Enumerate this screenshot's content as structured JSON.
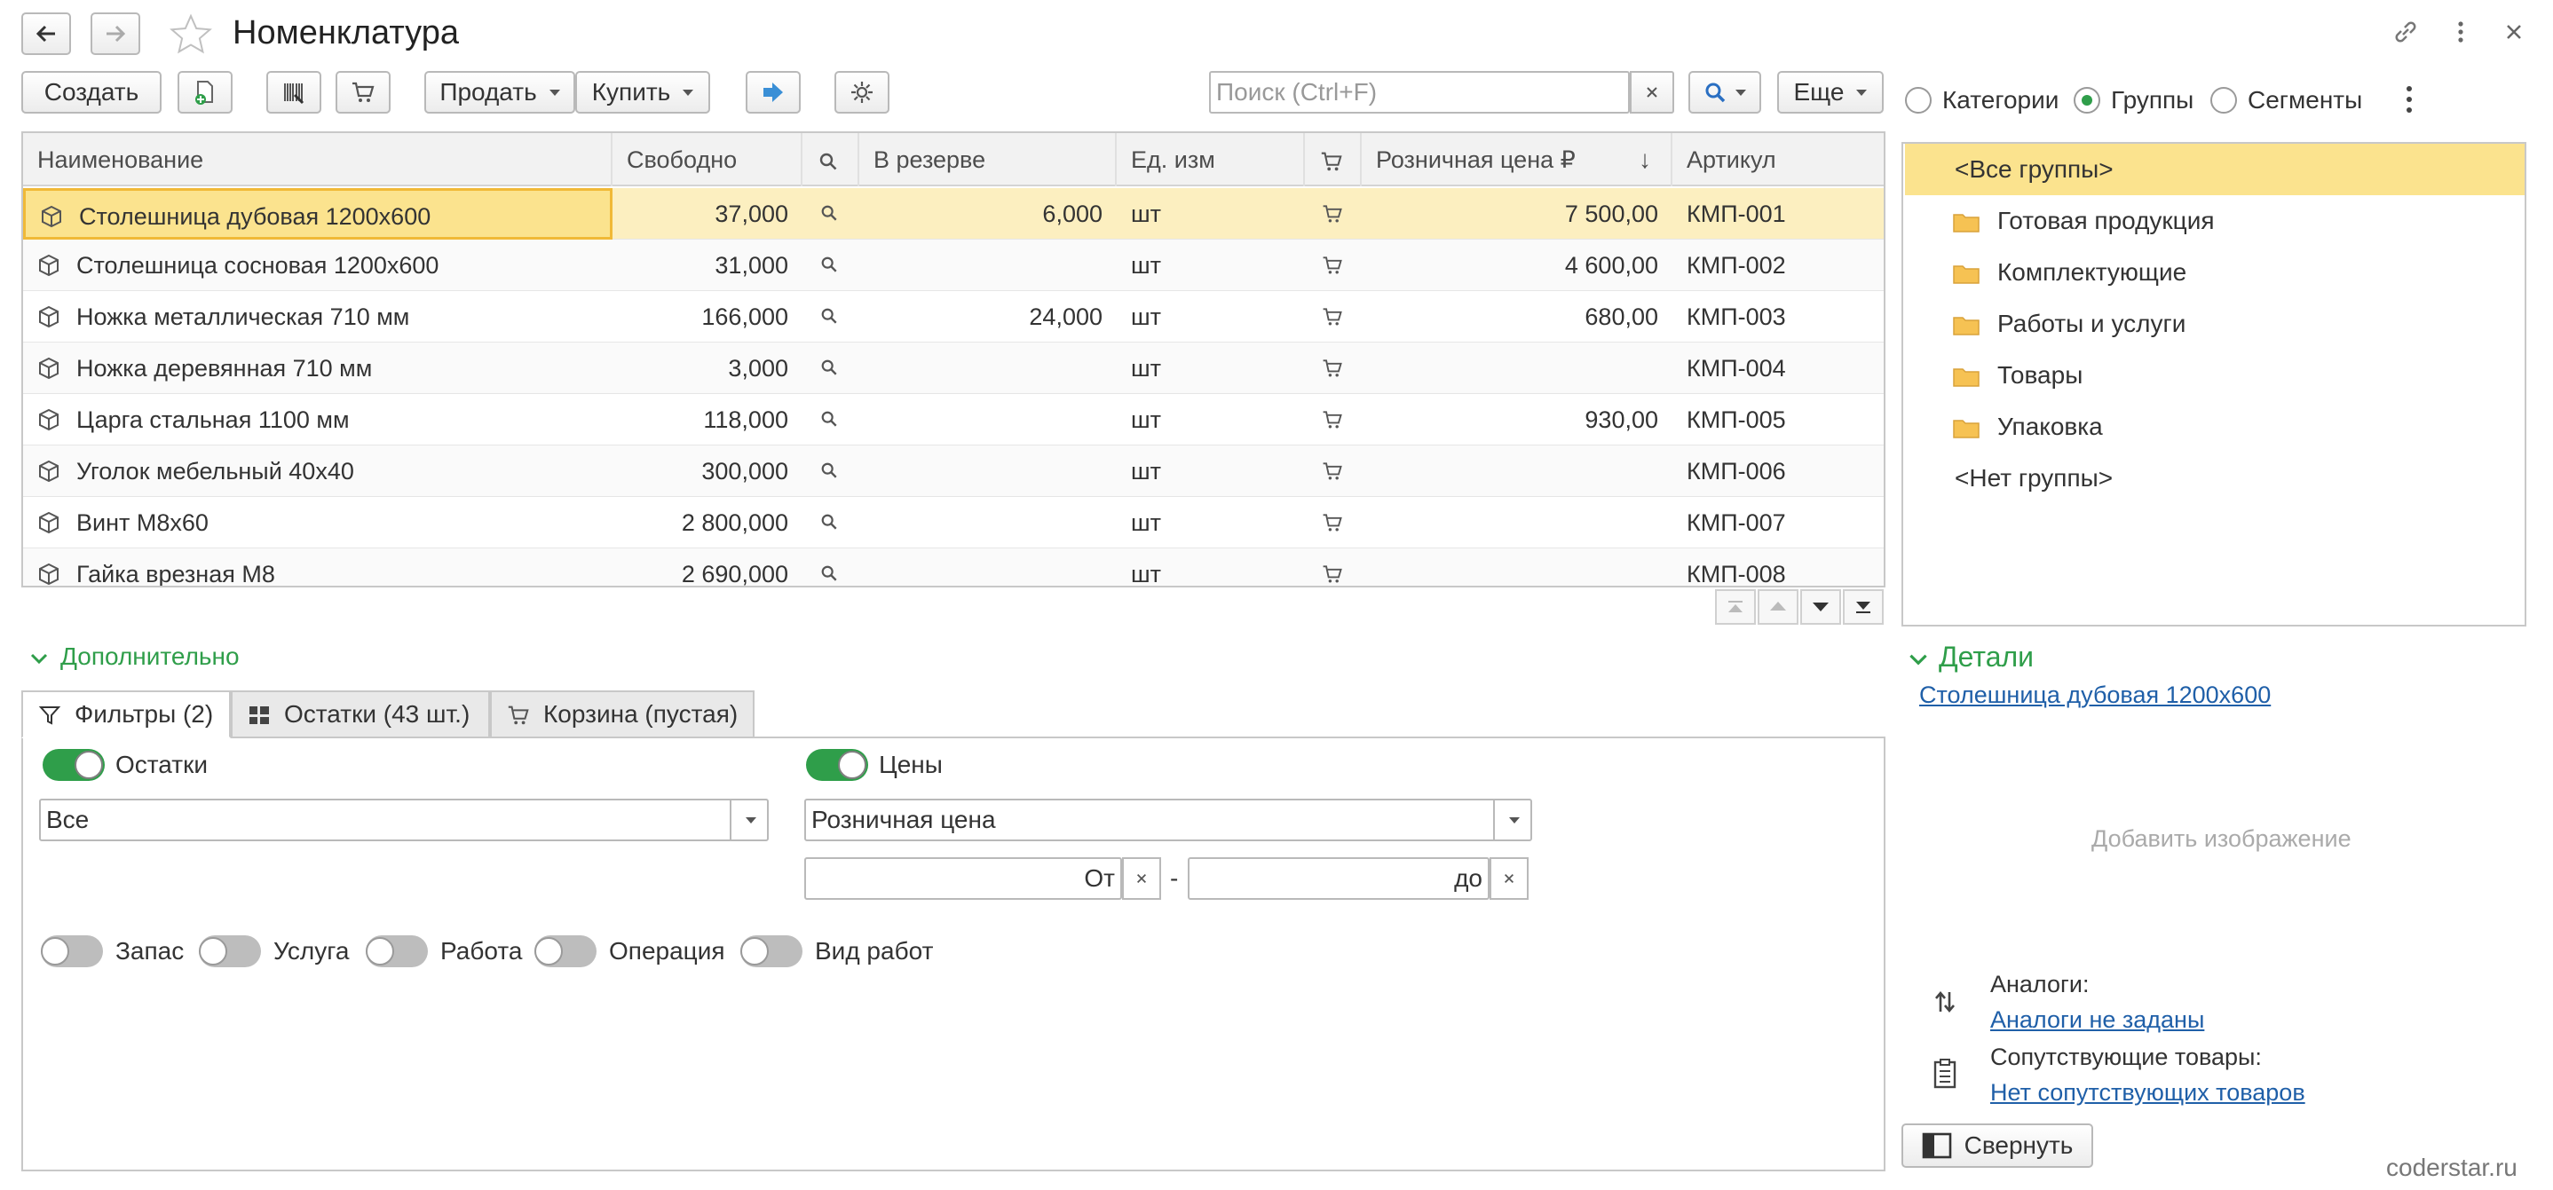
{
  "window": {
    "title": "Номенклатура",
    "watermark": "coderstar.ru"
  },
  "toolbar": {
    "create": "Создать",
    "sell": "Продать",
    "buy": "Купить",
    "search_placeholder": "Поиск (Ctrl+F)",
    "more": "Еще"
  },
  "grid": {
    "columns": {
      "name": "Наименование",
      "free": "Свободно",
      "reserve": "В резерве",
      "unit": "Ед. изм",
      "price": "Розничная цена ₽",
      "sku": "Артикул"
    },
    "rows": [
      {
        "name": "Столешница дубовая 1200х600",
        "free": "37,000",
        "reserve": "6,000",
        "unit": "шт",
        "price": "7 500,00",
        "sku": "КМП-001"
      },
      {
        "name": "Столешница сосновая 1200х600",
        "free": "31,000",
        "reserve": "",
        "unit": "шт",
        "price": "4 600,00",
        "sku": "КМП-002"
      },
      {
        "name": "Ножка металлическая 710 мм",
        "free": "166,000",
        "reserve": "24,000",
        "unit": "шт",
        "price": "680,00",
        "sku": "КМП-003"
      },
      {
        "name": "Ножка деревянная 710 мм",
        "free": "3,000",
        "reserve": "",
        "unit": "шт",
        "price": "",
        "sku": "КМП-004"
      },
      {
        "name": "Царга стальная 1100 мм",
        "free": "118,000",
        "reserve": "",
        "unit": "шт",
        "price": "930,00",
        "sku": "КМП-005"
      },
      {
        "name": "Уголок мебельный 40х40",
        "free": "300,000",
        "reserve": "",
        "unit": "шт",
        "price": "",
        "sku": "КМП-006"
      },
      {
        "name": "Винт М8х60",
        "free": "2 800,000",
        "reserve": "",
        "unit": "шт",
        "price": "",
        "sku": "КМП-007"
      },
      {
        "name": "Гайка врезная М8",
        "free": "2 690,000",
        "reserve": "",
        "unit": "шт",
        "price": "",
        "sku": "КМП-008"
      }
    ]
  },
  "extra": {
    "section_title": "Дополнительно",
    "tabs": [
      "Фильтры (2)",
      "Остатки (43 шт.)",
      "Корзина (пустая)"
    ],
    "stock_toggle": "Остатки",
    "stock_value": "Все",
    "prices_toggle": "Цены",
    "price_type": "Розничная цена",
    "from_label": "От",
    "to_label": "до",
    "range_separator": "-",
    "flags": [
      "Запас",
      "Услуга",
      "Работа",
      "Операция",
      "Вид работ"
    ]
  },
  "groups_panel": {
    "modes": [
      "Категории",
      "Группы",
      "Сегменты"
    ],
    "items": [
      "<Все группы>",
      "Готовая продукция",
      "Комплектующие",
      "Работы и услуги",
      "Товары",
      "Упаковка",
      "<Нет группы>"
    ]
  },
  "details": {
    "title": "Детали",
    "item_link": "Столешница дубовая 1200х600",
    "add_image": "Добавить изображение",
    "analogs_label": "Аналоги:",
    "analogs_link": "Аналоги не заданы",
    "related_label": "Сопутствующие товары:",
    "related_link": "Нет сопутствующих товаров",
    "collapse": "Свернуть"
  },
  "colors": {
    "accent_green": "#2f9e4a",
    "selection_yellow": "#fbe38e",
    "link_blue": "#1f5fa8"
  }
}
